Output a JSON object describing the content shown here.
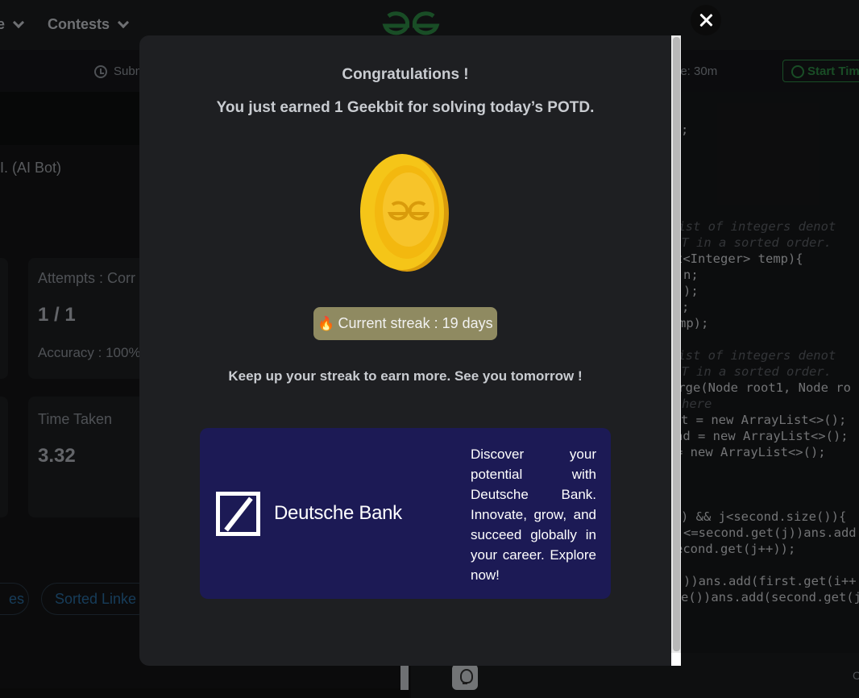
{
  "background": {
    "nav": {
      "item_partial": "e",
      "contests": "Contests"
    },
    "subbar": {
      "submissions_partial": "Subn",
      "time_partial": "ne: 30m",
      "start_timer": "Start Tim"
    },
    "ai_bot": "I. (AI Bot)",
    "stats": {
      "attempts_label": "Attempts : Corr",
      "attempts_value": "1 / 1",
      "accuracy_label": "Accuracy : 100%",
      "time_label": "Time Taken",
      "time_value": "3.32"
    },
    "tags": {
      "left_partial": "es",
      "sorted": "Sorted Linke"
    },
    "corner": "C",
    "code": [
      {
        "text": ";",
        "kind": "code"
      },
      {
        "text": " list of integers denot",
        "kind": "comment"
      },
      {
        "text": "ST in a sorted order.",
        "kind": "comment"
      },
      {
        "text": "t<Integer> temp){",
        "kind": "code"
      },
      {
        "text": "n;",
        "kind": "code"
      },
      {
        "text": ");",
        "kind": "code"
      },
      {
        "text": ";",
        "kind": "code"
      },
      {
        "text": "mp);",
        "kind": "code"
      },
      {
        "text": " list of integers denot",
        "kind": "comment"
      },
      {
        "text": "ST in a sorted order.",
        "kind": "comment"
      },
      {
        "text": "erge(Node root1, Node ro",
        "kind": "code"
      },
      {
        "text": "here",
        "kind": "comment"
      },
      {
        "text": "t = new ArrayList<>();",
        "kind": "code"
      },
      {
        "text": "nd = new ArrayList<>();",
        "kind": "code"
      },
      {
        "text": "= new ArrayList<>();",
        "kind": "code"
      },
      {
        "text": ") && j<second.size()){",
        "kind": "code"
      },
      {
        "text": "<=second.get(j))ans.add",
        "kind": "code"
      },
      {
        "text": "econd.get(j++));",
        "kind": "code"
      },
      {
        "text": "))ans.add(first.get(i++",
        "kind": "code"
      },
      {
        "text": "e())ans.add(second.get(j",
        "kind": "code"
      }
    ]
  },
  "modal": {
    "title": "Congratulations !",
    "subtitle": "You just earned 1 Geekbit for solving today’s POTD.",
    "coin_icon": "geekbit-coin-icon",
    "streak": {
      "icon": "🔥",
      "label": "Current streak : 19 days"
    },
    "keep_up": "Keep up your streak to earn more. See you tomorrow !",
    "ad": {
      "brand": "Deutsche Bank",
      "text": "Discover your potential with Deutsche Bank. Innovate, grow, and succeed globally in your career. Explore now!"
    },
    "close_icon": "close-icon"
  },
  "colors": {
    "accent_green": "#2f8d46",
    "streak_bg": "#8f8a61",
    "ad_bg": "#1c1a55",
    "coin_gold": "#f5c518"
  }
}
